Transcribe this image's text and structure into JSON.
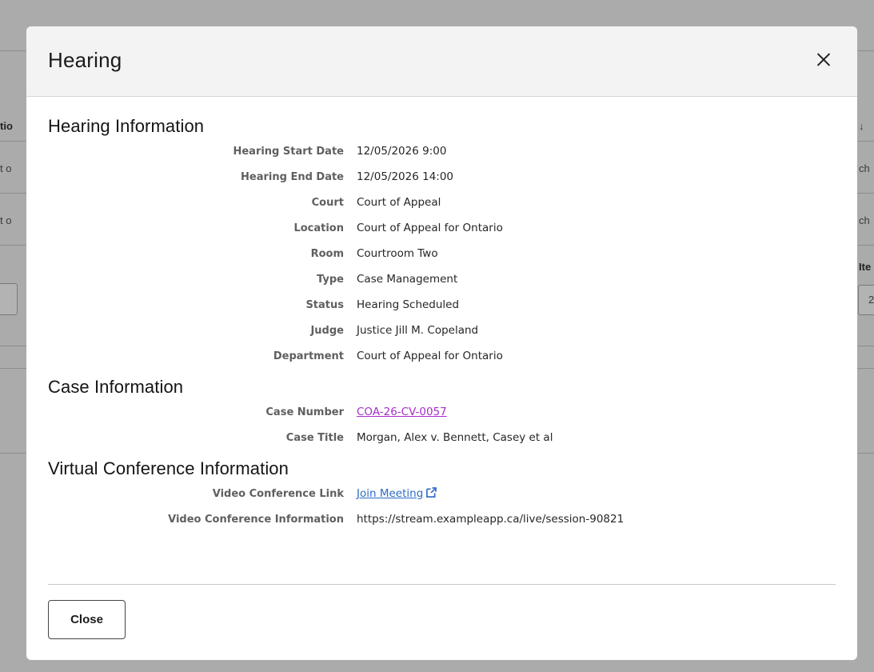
{
  "background": {
    "left_fragments": [
      "tio",
      "t o",
      "t o"
    ],
    "right_fragments": [
      "ch",
      "ch",
      "Ite",
      "2"
    ]
  },
  "modal": {
    "title": "Hearing",
    "close_icon": "close-icon",
    "sections": {
      "hearing": {
        "title": "Hearing Information",
        "rows": [
          {
            "label": "Hearing Start Date",
            "value": "12/05/2026 9:00"
          },
          {
            "label": "Hearing End Date",
            "value": "12/05/2026 14:00"
          },
          {
            "label": "Court",
            "value": "Court of Appeal"
          },
          {
            "label": "Location",
            "value": "Court of Appeal for Ontario"
          },
          {
            "label": "Room",
            "value": "Courtroom Two"
          },
          {
            "label": "Type",
            "value": "Case Management"
          },
          {
            "label": "Status",
            "value": "Hearing Scheduled"
          },
          {
            "label": "Judge",
            "value": "Justice Jill M. Copeland"
          },
          {
            "label": "Department",
            "value": "Court of Appeal for Ontario"
          }
        ]
      },
      "case": {
        "title": "Case Information",
        "case_number_label": "Case Number",
        "case_number": "COA-26-CV-0057",
        "case_title_label": "Case Title",
        "case_title": "Morgan, Alex v. Bennett, Casey et al"
      },
      "virtual": {
        "title": "Virtual Conference Information",
        "link_label": "Video Conference Link",
        "link_text": "Join Meeting",
        "link_icon": "external-link-icon",
        "info_label": "Video Conference Information",
        "info_value": "https://stream.exampleapp.ca/live/session-90821"
      }
    },
    "close_button": "Close"
  },
  "colors": {
    "link": "#2f6bc4",
    "visited_link": "#a52ec9",
    "header_bg": "#f3f3f3",
    "overlay": "#a9a9a9"
  }
}
